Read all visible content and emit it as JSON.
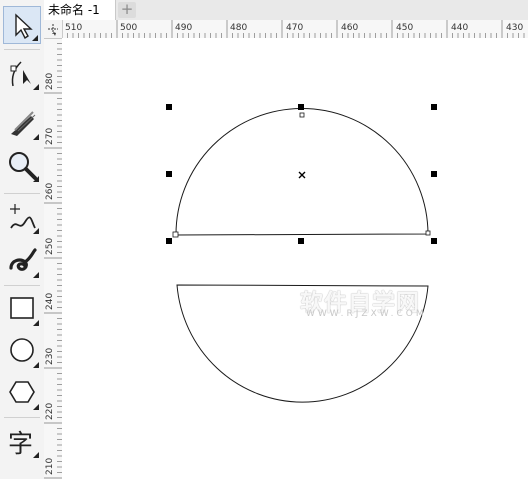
{
  "document": {
    "tab_title": "未命名 -1",
    "add_tab_symbol": "+"
  },
  "toolbox": {
    "tools": [
      {
        "name": "pick-tool",
        "icon": "arrow-pointer-icon",
        "active": true
      },
      {
        "name": "shape-tool",
        "icon": "shape-node-icon"
      },
      {
        "name": "crop-tool",
        "icon": "knife-icon"
      },
      {
        "name": "zoom-tool",
        "icon": "magnifier-icon"
      },
      {
        "name": "freehand-tool",
        "icon": "freehand-curve-icon"
      },
      {
        "name": "artistic-media-tool",
        "icon": "spiral-brush-icon"
      },
      {
        "name": "rectangle-tool",
        "icon": "rectangle-icon"
      },
      {
        "name": "ellipse-tool",
        "icon": "ellipse-icon"
      },
      {
        "name": "polygon-tool",
        "icon": "hexagon-icon"
      },
      {
        "name": "text-tool",
        "icon": "text-icon",
        "label": "字"
      }
    ]
  },
  "rulers": {
    "horizontal_labels": [
      "510",
      "500",
      "490",
      "480",
      "470",
      "460",
      "450",
      "440",
      "430"
    ],
    "vertical_labels": [
      "280",
      "270",
      "260",
      "250",
      "240",
      "230",
      "220",
      "210"
    ]
  },
  "watermark": {
    "text": "软件自学网",
    "subtext": "WWW.RJZXW.COM"
  },
  "colors": {
    "selection_handle": "#000000",
    "shape_stroke": "#1a1a1a",
    "tab_active": "#ffffff"
  }
}
